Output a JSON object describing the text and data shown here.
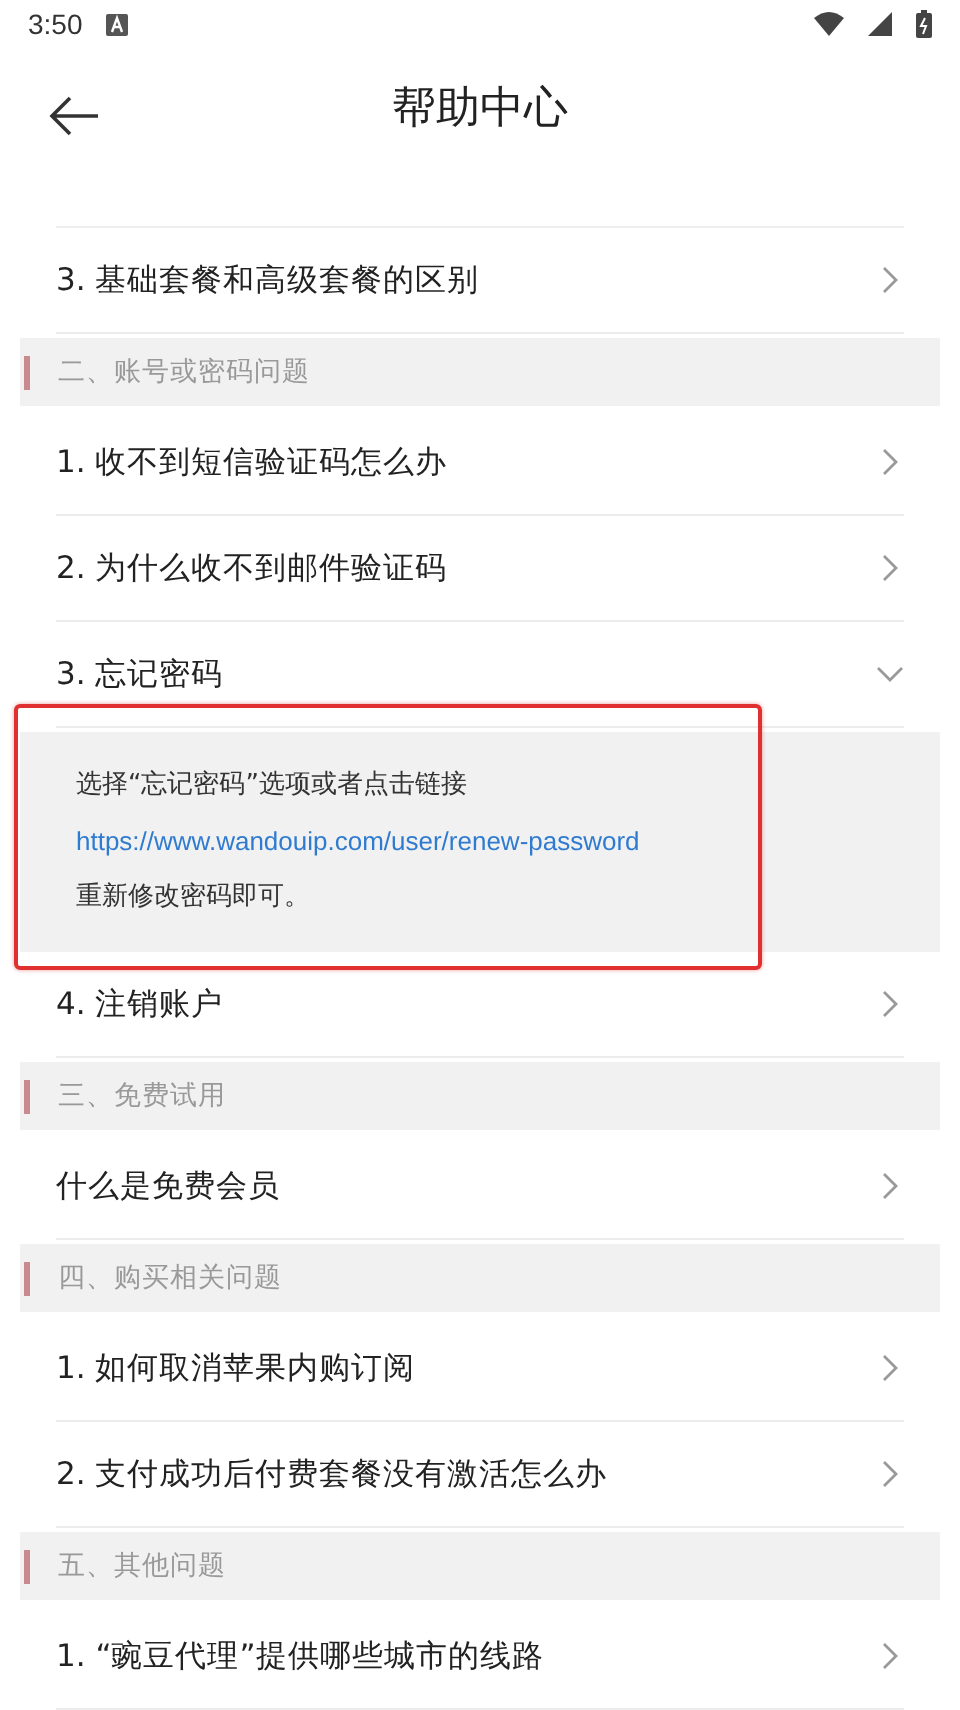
{
  "status_bar": {
    "time": "3:50"
  },
  "header": {
    "title": "帮助中心"
  },
  "items": [
    {
      "kind": "partial"
    },
    {
      "kind": "question",
      "text": "3. 基础套餐和高级套餐的区别",
      "expanded": false
    },
    {
      "kind": "section",
      "text": "二、账号或密码问题"
    },
    {
      "kind": "question",
      "text": "1. 收不到短信验证码怎么办",
      "expanded": false
    },
    {
      "kind": "question",
      "text": "2. 为什么收不到邮件验证码",
      "expanded": false
    },
    {
      "kind": "question",
      "text": "3. 忘记密码",
      "expanded": true,
      "answer": {
        "highlighted": true,
        "lines": [
          {
            "kind": "text",
            "text": "选择“忘记密码”选项或者点击链接"
          },
          {
            "kind": "link",
            "text": "https://www.wandouip.com/user/renew-password"
          },
          {
            "kind": "text",
            "text": "重新修改密码即可。"
          }
        ]
      }
    },
    {
      "kind": "question",
      "text": "4. 注销账户",
      "expanded": false
    },
    {
      "kind": "section",
      "text": "三、免费试用"
    },
    {
      "kind": "question",
      "text": "什么是免费会员",
      "expanded": false
    },
    {
      "kind": "section",
      "text": "四、购买相关问题"
    },
    {
      "kind": "question",
      "text": "1. 如何取消苹果内购订阅",
      "expanded": false
    },
    {
      "kind": "question",
      "text": "2. 支付成功后付费套餐没有激活怎么办",
      "expanded": false
    },
    {
      "kind": "section",
      "text": "五、其他问题"
    },
    {
      "kind": "question",
      "text": "1. “豌豆代理”提供哪些城市的线路",
      "expanded": false
    }
  ]
}
